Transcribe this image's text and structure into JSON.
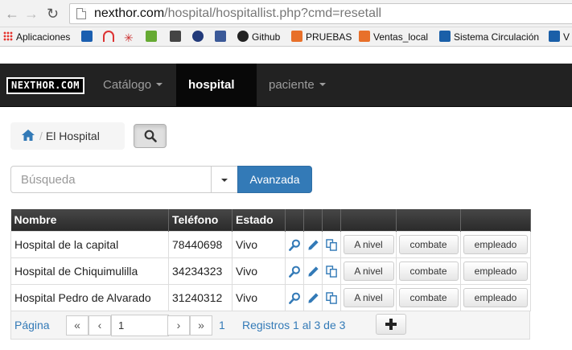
{
  "browser": {
    "url_host": "nexthor.com",
    "url_path": "/hospital/hospitallist.php?cmd=resetall",
    "bookmarks": [
      {
        "label": "Aplicaciones",
        "color": "#e5322d"
      },
      {
        "label": "",
        "color": "#1b5fb0"
      },
      {
        "label": "",
        "color": "#d33"
      },
      {
        "label": "",
        "color": "#c33"
      },
      {
        "label": "",
        "color": "#6a3"
      },
      {
        "label": "",
        "color": "#444"
      },
      {
        "label": "",
        "color": "#223a7a"
      },
      {
        "label": "",
        "color": "#3b5998"
      },
      {
        "label": "Github",
        "color": "#222"
      },
      {
        "label": "PRUEBAS",
        "color": "#e8702a"
      },
      {
        "label": "Ventas_local",
        "color": "#e8702a"
      },
      {
        "label": "Sistema Circulación",
        "color": "#1a5fa8"
      },
      {
        "label": "V",
        "color": "#1a5fa8"
      }
    ]
  },
  "navbar": {
    "brand": "NEXTHOR.COM",
    "items": [
      {
        "label": "Catálogo"
      },
      {
        "label": "hospital"
      },
      {
        "label": "paciente"
      }
    ]
  },
  "breadcrumb": {
    "current": "El Hospital"
  },
  "search": {
    "placeholder": "Búsqueda",
    "advanced_label": "Avanzada"
  },
  "table": {
    "columns": [
      "Nombre",
      "Teléfono",
      "Estado",
      "",
      "",
      "",
      "",
      "",
      ""
    ],
    "rows": [
      {
        "nombre": "Hospital de la capital",
        "telefono": "78440698",
        "estado": "Vivo",
        "btn1": "A nivel",
        "btn2": "combate",
        "btn3": "empleado"
      },
      {
        "nombre": "Hospital de Chiquimulilla",
        "telefono": "34234323",
        "estado": "Vivo",
        "btn1": "A nivel",
        "btn2": "combate",
        "btn3": "empleado"
      },
      {
        "nombre": "Hospital Pedro de Alvarado",
        "telefono": "31240312",
        "estado": "Vivo",
        "btn1": "A nivel",
        "btn2": "combate",
        "btn3": "empleado"
      }
    ]
  },
  "pager": {
    "label": "Página",
    "first": "«",
    "prev": "‹",
    "page_value": "1",
    "next": "›",
    "last": "»",
    "page_count": "1",
    "records": "Registros 1 al 3 de 3"
  },
  "colors": {
    "primary": "#337ab7",
    "navbar": "#222222",
    "header": "#333333"
  }
}
